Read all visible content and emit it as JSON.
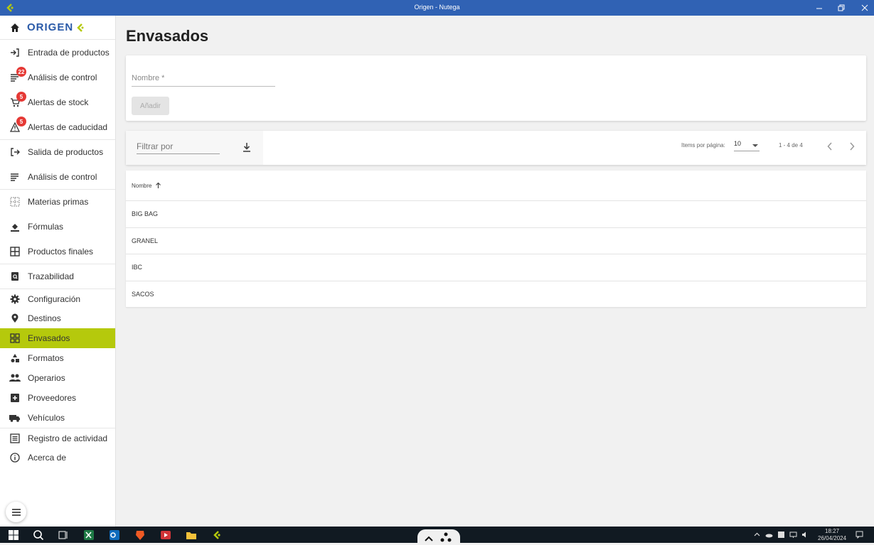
{
  "window": {
    "title": "Origen - Nutega",
    "brand_color": "#3062b4",
    "accent_color": "#b5c90c"
  },
  "sidebar": {
    "logo": "ORIGEN",
    "items": [
      {
        "label": "Entrada de productos",
        "icon": "login-icon",
        "badge": ""
      },
      {
        "label": "Análisis de control",
        "icon": "list-icon",
        "badge": "22"
      },
      {
        "label": "Alertas de stock",
        "icon": "cart-icon",
        "badge": "5"
      },
      {
        "label": "Alertas de caducidad",
        "icon": "warning-icon",
        "badge": "5"
      },
      {
        "label": "Salida de productos",
        "icon": "logout-icon",
        "badge": ""
      },
      {
        "label": "Análisis de control",
        "icon": "list-icon",
        "badge": ""
      },
      {
        "label": "Materias primas",
        "icon": "grid-dots-icon",
        "badge": ""
      },
      {
        "label": "Fórmulas",
        "icon": "paint-bucket-icon",
        "badge": ""
      },
      {
        "label": "Productos finales",
        "icon": "grid-icon",
        "badge": ""
      },
      {
        "label": "Trazabilidad",
        "icon": "search-doc-icon",
        "badge": ""
      },
      {
        "label": "Configuración",
        "icon": "gear-icon",
        "badge": ""
      },
      {
        "label": "Destinos",
        "icon": "pin-icon",
        "badge": ""
      },
      {
        "label": "Envasados",
        "icon": "apps-icon",
        "badge": ""
      },
      {
        "label": "Formatos",
        "icon": "shapes-icon",
        "badge": ""
      },
      {
        "label": "Operarios",
        "icon": "people-icon",
        "badge": ""
      },
      {
        "label": "Proveedores",
        "icon": "add-box-icon",
        "badge": ""
      },
      {
        "label": "Vehículos",
        "icon": "truck-icon",
        "badge": ""
      },
      {
        "label": "Registro de actividad",
        "icon": "list-alt-icon",
        "badge": ""
      },
      {
        "label": "Acerca de",
        "icon": "info-icon",
        "badge": ""
      }
    ]
  },
  "main": {
    "title": "Envasados",
    "form": {
      "name_placeholder": "Nombre *",
      "add_label": "Añadir"
    },
    "toolbar": {
      "filter_placeholder": "Filtrar por",
      "items_per_page_label": "Items por página:",
      "items_per_page_value": "10",
      "range_label": "1 - 4 de 4"
    },
    "table": {
      "header": "Nombre",
      "rows": [
        "BIG BAG",
        "GRANEL",
        "IBC",
        "SACOS"
      ]
    }
  },
  "taskbar": {
    "time": "18:27",
    "date": "26/04/2024"
  }
}
